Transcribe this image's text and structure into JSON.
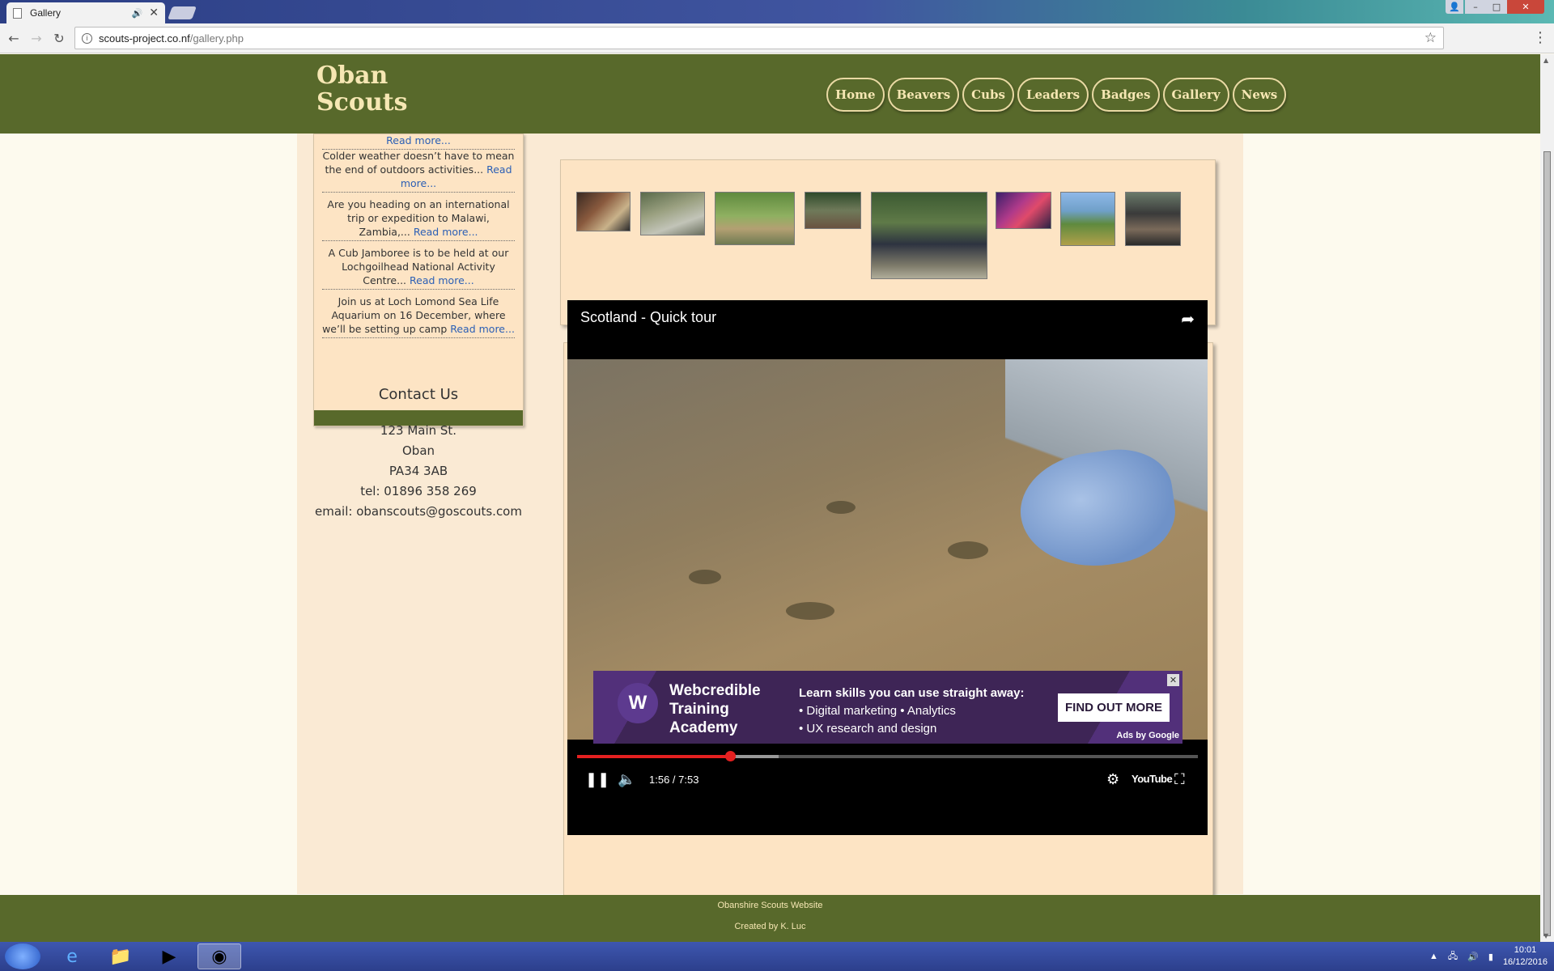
{
  "browser": {
    "tab_title": "Gallery",
    "url_host": "scouts-project.co.nf",
    "url_path": "/gallery.php"
  },
  "site": {
    "logo_line1": "Oban",
    "logo_line2": "Scouts",
    "nav": [
      "Home",
      "Beavers",
      "Cubs",
      "Leaders",
      "Badges",
      "Gallery",
      "News"
    ]
  },
  "news": {
    "items": [
      {
        "text": "",
        "more": "Read more..."
      },
      {
        "text": "Colder weather doesn’t have to mean the end of outdoors activities... ",
        "more": "Read more..."
      },
      {
        "text": "Are you heading on an international trip or expedition to Malawi, Zambia,... ",
        "more": "Read more..."
      },
      {
        "text": "A Cub Jamboree is to be held at our Lochgoilhead National Activity Centre... ",
        "more": "Read more..."
      },
      {
        "text": "Join us at Loch Lomond Sea Life Aquarium on 16 December, where we’ll be setting up camp ",
        "more": "Read more..."
      }
    ]
  },
  "contact": {
    "title": "Contact Us",
    "address1": "123 Main St.",
    "address2": "Oban",
    "postcode": "PA34 3AB",
    "tel": "tel: 01896 358 269",
    "email": "email: obanscouts@goscouts.com"
  },
  "video": {
    "title": "Scotland - Quick tour",
    "current_time": "1:56",
    "duration": "7:53",
    "time_display": "1:56 / 7:53",
    "played_fraction": 0.246,
    "loaded_fraction": 0.325,
    "ad": {
      "brand": "Webcredible Training Academy",
      "logo_letter": "W",
      "headline": "Learn skills you can use straight away:",
      "bullet1": "• Digital marketing • Analytics",
      "bullet2": "• UX research and design",
      "cta": "FIND OUT MORE",
      "attribution": "Ads by Google"
    },
    "yt_label": "YouTube"
  },
  "footer": {
    "line1": "Obanshire Scouts Website",
    "line2": "Created by K. Luc"
  },
  "taskbar": {
    "time": "10:01",
    "date": "16/12/2016"
  }
}
